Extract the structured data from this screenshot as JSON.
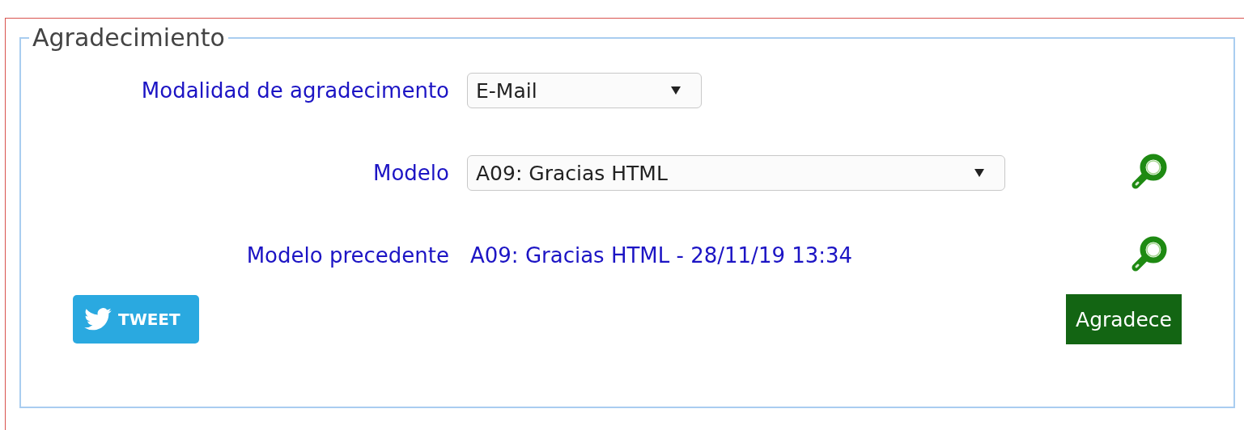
{
  "legend": "Agradecimiento",
  "fields": [
    {
      "kind": "select",
      "label": "Modalidad de agradecimento",
      "value": "E-Mail",
      "lookup": false
    },
    {
      "kind": "select",
      "label": "Modelo",
      "value": "A09: Gracias HTML",
      "lookup": true
    },
    {
      "kind": "text",
      "label": "Modelo precedente",
      "value": "A09: Gracias HTML - 28/11/19 13:34",
      "lookup": true
    }
  ],
  "tweet_button": {
    "label": "TWEET"
  },
  "submit_button": {
    "label": "Agradece"
  }
}
